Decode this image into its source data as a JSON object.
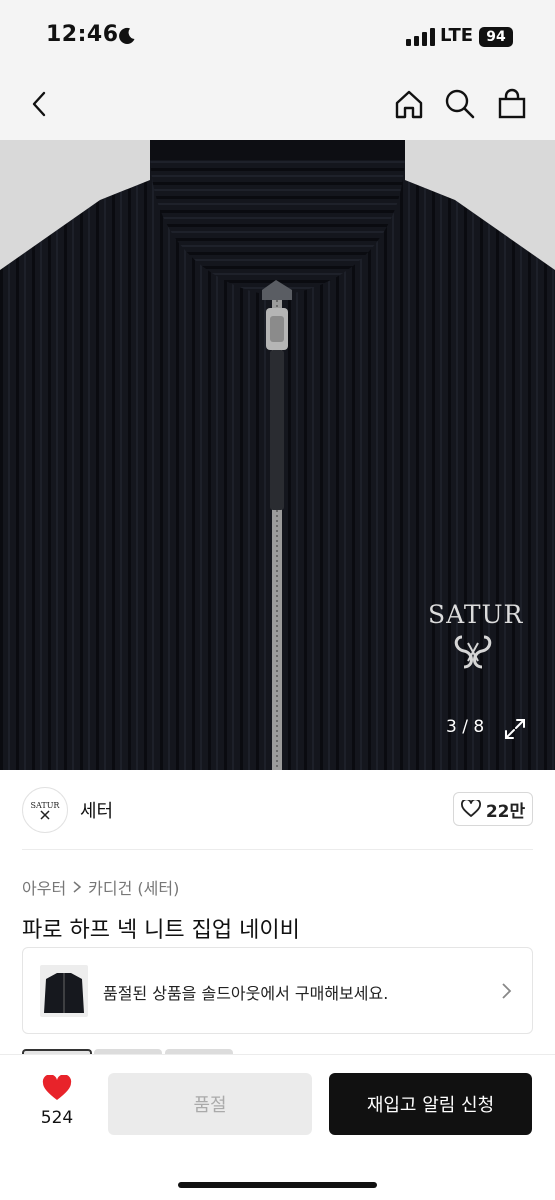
{
  "status_bar": {
    "time": "12:46",
    "network": "LTE",
    "battery": "94"
  },
  "nav": {
    "icons": [
      "back-icon",
      "home-icon",
      "search-icon",
      "shopping-bag-icon"
    ]
  },
  "product_image": {
    "brand_embroidery": "SATUR",
    "counter": "3 / 8"
  },
  "brand": {
    "logo_text": "SATUR",
    "name": "세터",
    "likes": "22만"
  },
  "breadcrumb": {
    "parent": "아우터",
    "child": "카디건 (세터)"
  },
  "product": {
    "title": "파로 하프 넥 니트 집업 네이비"
  },
  "soldout_banner": {
    "text": "품절된 상품을 솔드아웃에서 구매해보세요."
  },
  "bottom_bar": {
    "wish_count": "524",
    "soldout_label": "품절",
    "restock_label": "재입고 알림 신청"
  },
  "colors": {
    "accent": "#111111",
    "heart": "#e8232a",
    "sweater": "#14161d"
  }
}
